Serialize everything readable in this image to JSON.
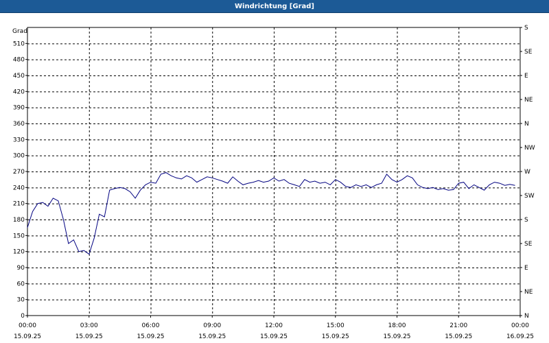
{
  "window": {
    "title": "Windrichtung [Grad]"
  },
  "colors": {
    "title_bar": "#1c5a96",
    "line": "#000080",
    "grid": "#000000",
    "background": "#ffffff"
  },
  "chart_data": {
    "type": "line",
    "title": "Windrichtung [Grad]",
    "ylabel": "Grad",
    "ylim": [
      0,
      540
    ],
    "yticks": [
      0,
      30,
      60,
      90,
      120,
      150,
      180,
      210,
      240,
      270,
      300,
      330,
      360,
      390,
      420,
      450,
      480,
      510
    ],
    "xlim_hours": [
      0,
      24
    ],
    "xticks": [
      {
        "hour": 0,
        "time": "00:00",
        "date": "15.09.25"
      },
      {
        "hour": 3,
        "time": "03:00",
        "date": "15.09.25"
      },
      {
        "hour": 6,
        "time": "06:00",
        "date": "15.09.25"
      },
      {
        "hour": 9,
        "time": "09:00",
        "date": "15.09.25"
      },
      {
        "hour": 12,
        "time": "12:00",
        "date": "15.09.25"
      },
      {
        "hour": 15,
        "time": "15:00",
        "date": "15.09.25"
      },
      {
        "hour": 18,
        "time": "18:00",
        "date": "15.09.25"
      },
      {
        "hour": 21,
        "time": "21:00",
        "date": "15.09.25"
      },
      {
        "hour": 24,
        "time": "00:00",
        "date": "16.09.25"
      }
    ],
    "right_axis": [
      {
        "value": 0,
        "label": "N"
      },
      {
        "value": 45,
        "label": "NE"
      },
      {
        "value": 90,
        "label": "E"
      },
      {
        "value": 135,
        "label": "SE"
      },
      {
        "value": 180,
        "label": "S"
      },
      {
        "value": 225,
        "label": "SW"
      },
      {
        "value": 270,
        "label": "W"
      },
      {
        "value": 315,
        "label": "NW"
      },
      {
        "value": 360,
        "label": "N"
      },
      {
        "value": 405,
        "label": "NE"
      },
      {
        "value": 450,
        "label": "E"
      },
      {
        "value": 495,
        "label": "SE"
      },
      {
        "value": 540,
        "label": "S"
      }
    ],
    "grid": true,
    "series": [
      {
        "x_hours": [
          0.0,
          0.25,
          0.5,
          0.75,
          1.0,
          1.25,
          1.5,
          1.75,
          2.0,
          2.25,
          2.5,
          2.75,
          3.0,
          3.25,
          3.5,
          3.75,
          4.0,
          4.25,
          4.5,
          4.75,
          5.0,
          5.25,
          5.5,
          5.75,
          6.0,
          6.25,
          6.5,
          6.75,
          7.0,
          7.25,
          7.5,
          7.75,
          8.0,
          8.25,
          8.5,
          8.75,
          9.0,
          9.25,
          9.5,
          9.75,
          10.0,
          10.25,
          10.5,
          10.75,
          11.0,
          11.25,
          11.5,
          11.75,
          12.0,
          12.25,
          12.5,
          12.75,
          13.0,
          13.25,
          13.5,
          13.75,
          14.0,
          14.25,
          14.5,
          14.75,
          15.0,
          15.25,
          15.5,
          15.75,
          16.0,
          16.25,
          16.5,
          16.75,
          17.0,
          17.25,
          17.5,
          17.75,
          18.0,
          18.25,
          18.5,
          18.75,
          19.0,
          19.25,
          19.5,
          19.75,
          20.0,
          20.25,
          20.5,
          20.75,
          21.0,
          21.25,
          21.5,
          21.75,
          22.0,
          22.25,
          22.5,
          22.75,
          23.0,
          23.25,
          23.5,
          23.75
        ],
        "values": [
          165,
          195,
          210,
          212,
          205,
          220,
          215,
          180,
          135,
          142,
          120,
          122,
          115,
          145,
          190,
          185,
          235,
          238,
          240,
          238,
          232,
          220,
          235,
          245,
          250,
          248,
          265,
          268,
          262,
          258,
          256,
          262,
          258,
          250,
          255,
          260,
          258,
          255,
          252,
          248,
          260,
          252,
          245,
          248,
          250,
          253,
          250,
          252,
          258,
          252,
          255,
          248,
          245,
          242,
          255,
          250,
          252,
          248,
          250,
          245,
          255,
          250,
          242,
          240,
          245,
          242,
          245,
          240,
          245,
          248,
          265,
          255,
          250,
          255,
          262,
          258,
          245,
          240,
          238,
          240,
          236,
          238,
          235,
          236,
          248,
          250,
          238,
          245,
          240,
          235,
          245,
          250,
          248,
          244,
          246,
          244
        ]
      }
    ]
  }
}
